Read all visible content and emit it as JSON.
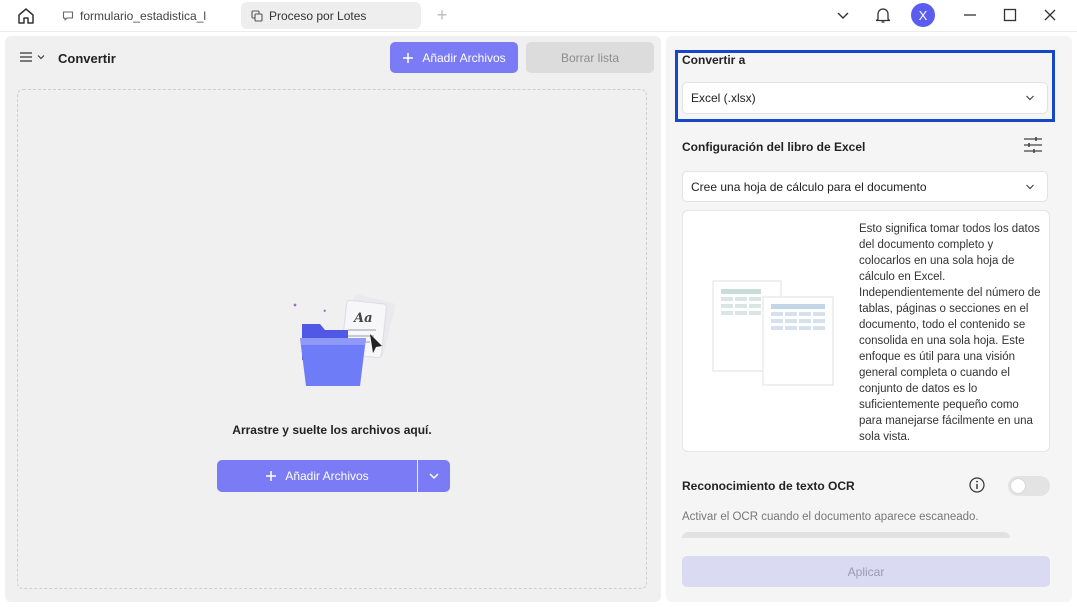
{
  "titlebar": {
    "tabs": [
      {
        "label": "formulario_estadistica_l",
        "icon": "comment-icon",
        "active": false
      },
      {
        "label": "Proceso por Lotes",
        "icon": "batch-icon",
        "active": true
      }
    ],
    "add_tab": "+",
    "avatar_initial": "X"
  },
  "left": {
    "title": "Convertir",
    "add_files_label": "Añadir Archivos",
    "clear_list_label": "Borrar lista",
    "drop_text": "Arrastre y suelte los archivos aquí.",
    "add_files_center_label": "Añadir Archivos"
  },
  "right": {
    "convert_to_label": "Convertir a",
    "format_value": "Excel (.xlsx)",
    "workbook_settings_label": "Configuración del libro de Excel",
    "mode_value": "Cree una hoja de cálculo para el documento",
    "mode_description": "Esto significa tomar todos los datos del documento completo y colocarlos en una sola hoja de cálculo en Excel. Independientemente del número de tablas, páginas o secciones en el documento, todo el contenido se consolida en una sola hoja. Este enfoque es útil para una visión general completa o cuando el conjunto de datos es lo suficientemente pequeño como para manejarse fácilmente en una sola vista.",
    "ocr_label": "Reconocimiento de texto OCR",
    "ocr_enabled": false,
    "ocr_description": "Activar el OCR cuando el documento aparece escaneado.",
    "apply_label": "Aplicar"
  },
  "colors": {
    "accent": "#7b7bf6",
    "highlight_border": "#1746c8",
    "avatar": "#5a5df0"
  }
}
